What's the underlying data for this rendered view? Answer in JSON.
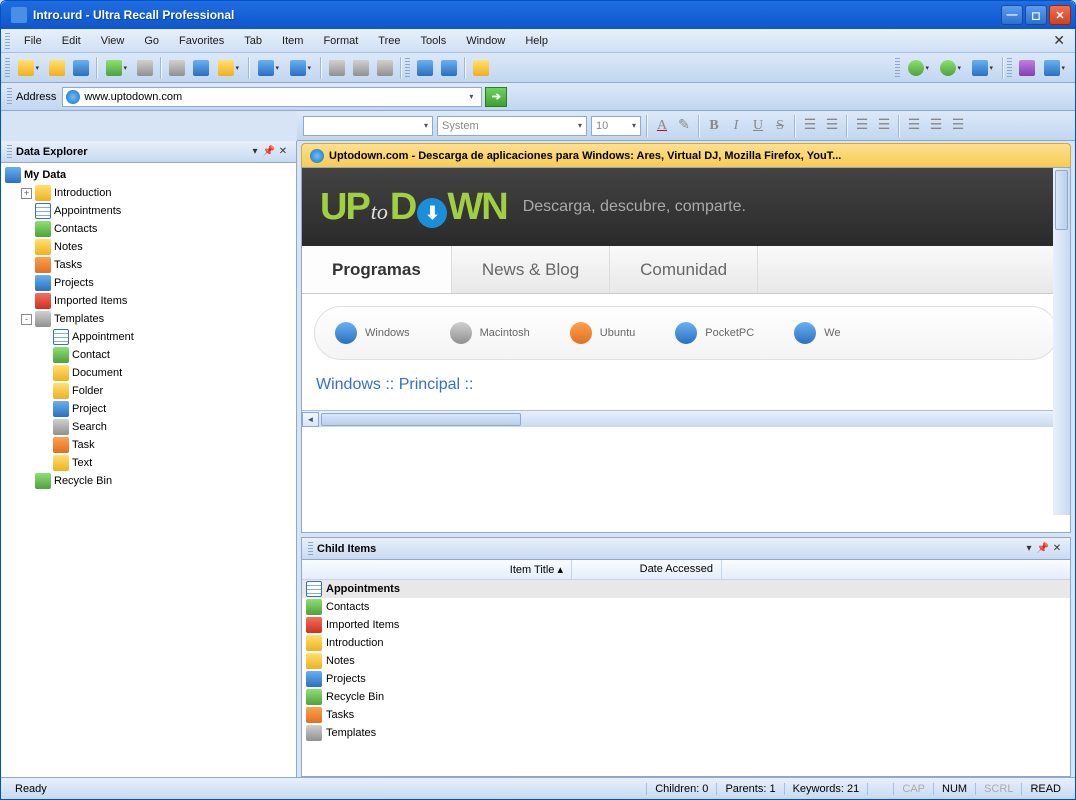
{
  "window": {
    "title": "Intro.urd - Ultra Recall Professional"
  },
  "menu": [
    "File",
    "Edit",
    "View",
    "Go",
    "Favorites",
    "Tab",
    "Item",
    "Format",
    "Tree",
    "Tools",
    "Window",
    "Help"
  ],
  "address": {
    "label": "Address",
    "value": "www.uptodown.com"
  },
  "format": {
    "style": "",
    "font": "System",
    "size": "10"
  },
  "explorer": {
    "title": "Data Explorer",
    "root": "My Data",
    "items": [
      {
        "label": "Introduction",
        "exp": "+",
        "ico": "ic-yel"
      },
      {
        "label": "Appointments",
        "ico": "ic-cal"
      },
      {
        "label": "Contacts",
        "ico": "ic-grn"
      },
      {
        "label": "Notes",
        "ico": "ic-yel"
      },
      {
        "label": "Tasks",
        "ico": "ic-org"
      },
      {
        "label": "Projects",
        "ico": "ic-blue"
      },
      {
        "label": "Imported Items",
        "ico": "ic-red"
      },
      {
        "label": "Templates",
        "exp": "-",
        "ico": "ic-gry",
        "children": [
          {
            "label": "Appointment",
            "ico": "ic-cal"
          },
          {
            "label": "Contact",
            "ico": "ic-grn"
          },
          {
            "label": "Document",
            "ico": "ic-yel"
          },
          {
            "label": "Folder",
            "ico": "ic-yel"
          },
          {
            "label": "Project",
            "ico": "ic-blue"
          },
          {
            "label": "Search",
            "ico": "ic-gry"
          },
          {
            "label": "Task",
            "ico": "ic-org"
          },
          {
            "label": "Text",
            "ico": "ic-yel"
          }
        ]
      },
      {
        "label": "Recycle Bin",
        "ico": "ic-grn"
      }
    ]
  },
  "content": {
    "tab_title": "Uptodown.com - Descarga de aplicaciones para Windows: Ares, Virtual DJ, Mozilla Firefox, YouT...",
    "tagline": "Descarga, descubre, comparte.",
    "nav": [
      "Programas",
      "News & Blog",
      "Comunidad"
    ],
    "os": [
      "Windows",
      "Macintosh",
      "Ubuntu",
      "PocketPC",
      "We"
    ],
    "breadcrumb": "Windows :: Principal ::"
  },
  "child": {
    "title": "Child Items",
    "cols": [
      "Item Title",
      "Date Accessed"
    ],
    "rows": [
      {
        "t": "Appointments",
        "ico": "ic-cal",
        "sel": true
      },
      {
        "t": "Contacts",
        "ico": "ic-grn"
      },
      {
        "t": "Imported Items",
        "ico": "ic-red"
      },
      {
        "t": "Introduction",
        "ico": "ic-yel"
      },
      {
        "t": "Notes",
        "ico": "ic-yel"
      },
      {
        "t": "Projects",
        "ico": "ic-blue"
      },
      {
        "t": "Recycle Bin",
        "ico": "ic-grn"
      },
      {
        "t": "Tasks",
        "ico": "ic-org"
      },
      {
        "t": "Templates",
        "ico": "ic-gry"
      }
    ]
  },
  "status": {
    "ready": "Ready",
    "children": "Children: 0",
    "parents": "Parents: 1",
    "keywords": "Keywords: 21",
    "cap": "CAP",
    "num": "NUM",
    "scrl": "SCRL",
    "read": "READ"
  }
}
